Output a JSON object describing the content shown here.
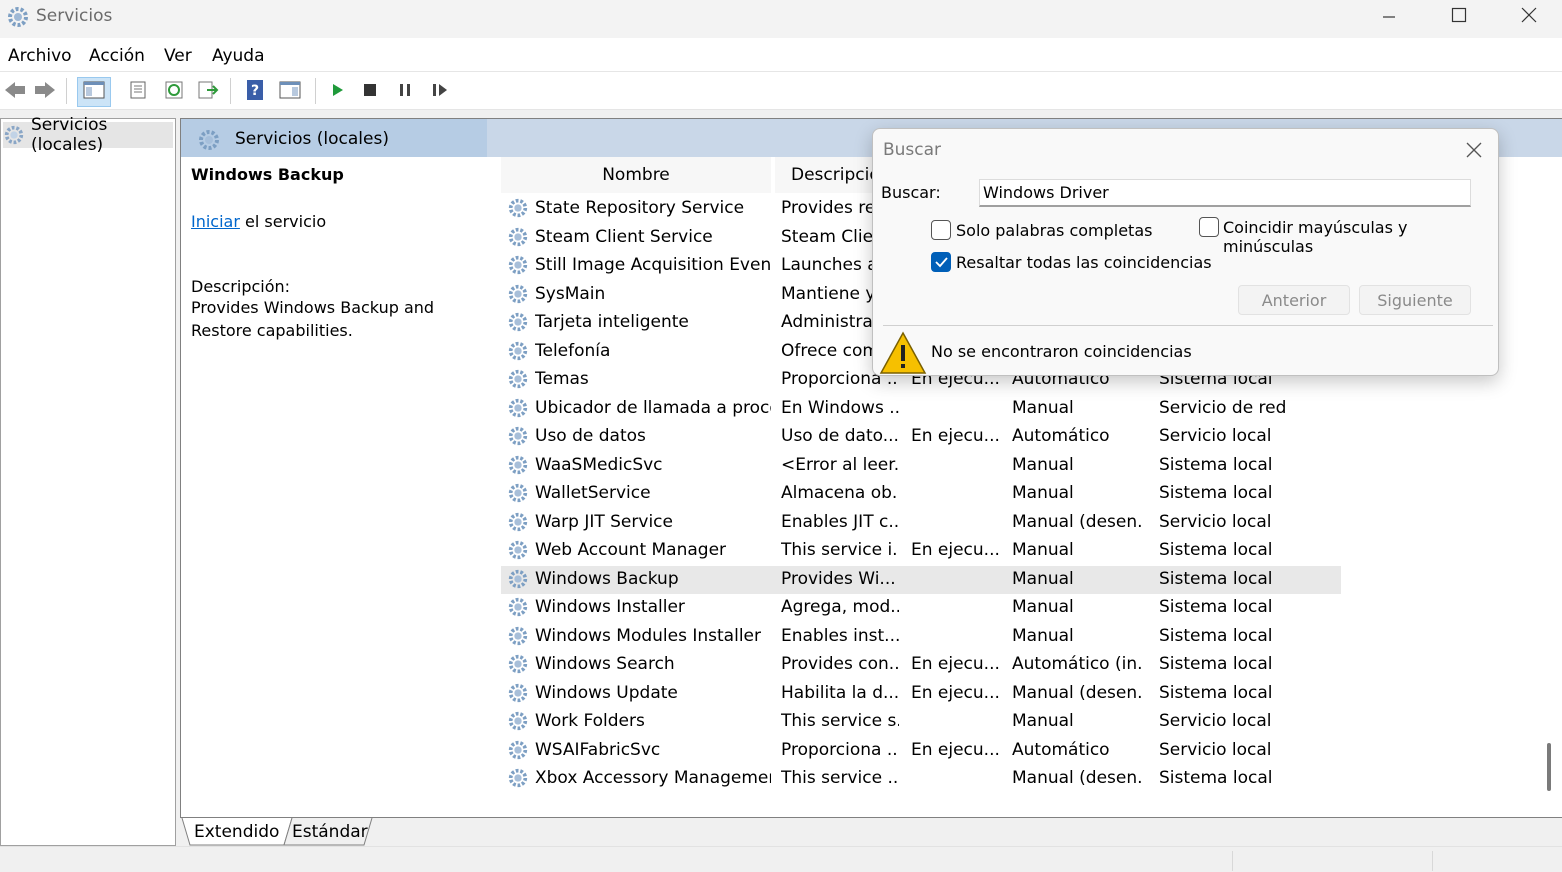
{
  "window": {
    "title": "Servicios"
  },
  "menu": [
    "Archivo",
    "Acción",
    "Ver",
    "Ayuda"
  ],
  "tree": {
    "root": "Servicios (locales)"
  },
  "panel": {
    "header": "Servicios (locales)",
    "selected_service": "Windows Backup",
    "start_link": "Iniciar",
    "start_suffix": " el servicio",
    "description_label": "Descripción:",
    "description_text": "Provides Windows Backup and Restore capabilities."
  },
  "list": {
    "columns": [
      "Nombre",
      "Descripció"
    ],
    "rows": [
      {
        "name": "State Repository Service",
        "desc": "Provides rec",
        "status": "",
        "startup": "",
        "logon": ""
      },
      {
        "name": "Steam Client Service",
        "desc": "Steam Clien",
        "status": "",
        "startup": "",
        "logon": ""
      },
      {
        "name": "Still Image Acquisition Events",
        "desc": "Launches ap",
        "status": "",
        "startup": "",
        "logon": ""
      },
      {
        "name": "SysMain",
        "desc": "Mantiene y",
        "status": "",
        "startup": "",
        "logon": ""
      },
      {
        "name": "Tarjeta inteligente",
        "desc": "Administra e",
        "status": "",
        "startup": "",
        "logon": ""
      },
      {
        "name": "Telefonía",
        "desc": "Ofrece comp",
        "status": "",
        "startup": "",
        "logon": ""
      },
      {
        "name": "Temas",
        "desc": "Proporciona ...",
        "status": "En ejecu...",
        "startup": "Automático",
        "logon": "Sistema local"
      },
      {
        "name": "Ubicador de llamada a proce...",
        "desc": "En Windows ...",
        "status": "",
        "startup": "Manual",
        "logon": "Servicio de red"
      },
      {
        "name": "Uso de datos",
        "desc": "Uso de dato...",
        "status": "En ejecu...",
        "startup": "Automático",
        "logon": "Servicio local"
      },
      {
        "name": "WaaSMedicSvc",
        "desc": "<Error al leer...",
        "status": "",
        "startup": "Manual",
        "logon": "Sistema local"
      },
      {
        "name": "WalletService",
        "desc": "Almacena ob...",
        "status": "",
        "startup": "Manual",
        "logon": "Sistema local"
      },
      {
        "name": "Warp JIT Service",
        "desc": "Enables JIT c...",
        "status": "",
        "startup": "Manual (desen...",
        "logon": "Servicio local"
      },
      {
        "name": "Web Account Manager",
        "desc": "This service i...",
        "status": "En ejecu...",
        "startup": "Manual",
        "logon": "Sistema local"
      },
      {
        "name": "Windows Backup",
        "desc": "Provides Wi...",
        "status": "",
        "startup": "Manual",
        "logon": "Sistema local"
      },
      {
        "name": "Windows Installer",
        "desc": "Agrega, mod...",
        "status": "",
        "startup": "Manual",
        "logon": "Sistema local"
      },
      {
        "name": "Windows Modules Installer",
        "desc": "Enables inst...",
        "status": "",
        "startup": "Manual",
        "logon": "Sistema local"
      },
      {
        "name": "Windows Search",
        "desc": "Provides con...",
        "status": "En ejecu...",
        "startup": "Automático (in...",
        "logon": "Sistema local"
      },
      {
        "name": "Windows Update",
        "desc": "Habilita la d...",
        "status": "En ejecu...",
        "startup": "Manual (desen...",
        "logon": "Sistema local"
      },
      {
        "name": "Work Folders",
        "desc": "This service s...",
        "status": "",
        "startup": "Manual",
        "logon": "Servicio local"
      },
      {
        "name": "WSAIFabricSvc",
        "desc": "Proporciona ...",
        "status": "En ejecu...",
        "startup": "Automático",
        "logon": "Servicio local"
      },
      {
        "name": "Xbox Accessory Managemen...",
        "desc": "This service ...",
        "status": "",
        "startup": "Manual (desen...",
        "logon": "Sistema local"
      }
    ],
    "selected_index": 13
  },
  "tabs": [
    "Extendido",
    "Estándar"
  ],
  "find_dialog": {
    "title": "Buscar",
    "field_label": "Buscar:",
    "field_value": "Windows Driver",
    "option_whole_words": "Solo palabras completas",
    "option_whole_words_checked": false,
    "option_match_case": "Coincidir mayúsculas y minúsculas",
    "option_match_case_checked": false,
    "option_highlight_all": "Resaltar todas las coincidencias",
    "option_highlight_all_checked": true,
    "prev_button": "Anterior",
    "next_button": "Siguiente",
    "message": "No se encontraron coincidencias"
  },
  "colors": {
    "accent": "#005fb8",
    "panel_header": "#c9d7e8",
    "link": "#0066cc"
  }
}
